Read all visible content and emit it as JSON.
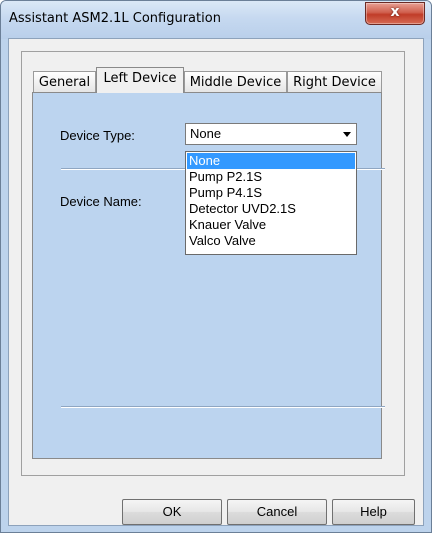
{
  "window": {
    "title": "Assistant ASM2.1L Configuration",
    "close_label": "x"
  },
  "tabs": [
    {
      "label": "General"
    },
    {
      "label": "Left Device"
    },
    {
      "label": "Middle Device"
    },
    {
      "label": "Right Device"
    }
  ],
  "left_device": {
    "device_type_label": "Device Type:",
    "device_type_value": "None",
    "device_name_label": "Device Name:",
    "options": [
      {
        "label": "None",
        "selected": true
      },
      {
        "label": "Pump P2.1S"
      },
      {
        "label": "Pump P4.1S"
      },
      {
        "label": "Detector UVD2.1S"
      },
      {
        "label": "Knauer Valve"
      },
      {
        "label": "Valco Valve"
      }
    ]
  },
  "buttons": {
    "ok": "OK",
    "cancel": "Cancel",
    "help": "Help"
  },
  "colors": {
    "selection": "#3399ff",
    "page_bg": "#bcd4ef",
    "title_bg": "#c6d9f0",
    "close": "#c9432f"
  }
}
